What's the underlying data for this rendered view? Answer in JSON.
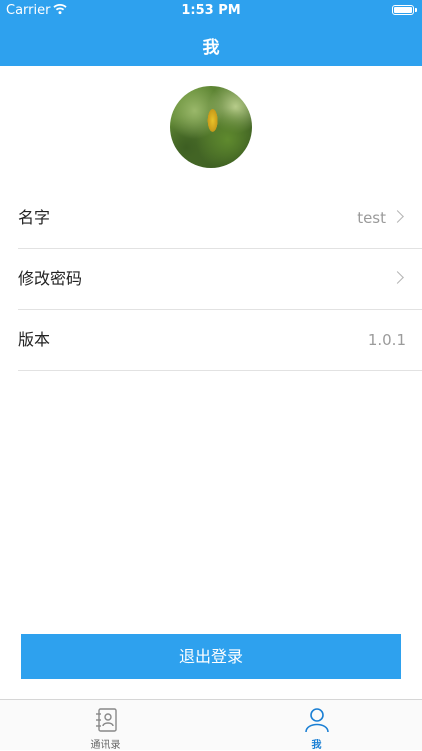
{
  "status_bar": {
    "carrier": "Carrier",
    "time": "1:53 PM"
  },
  "nav": {
    "title": "我"
  },
  "profile": {
    "rows": [
      {
        "label": "名字",
        "value": "test"
      },
      {
        "label": "修改密码",
        "value": ""
      },
      {
        "label": "版本",
        "value": "1.0.1"
      }
    ],
    "logout_label": "退出登录"
  },
  "tab_bar": {
    "tabs": [
      {
        "label": "通讯录",
        "icon": "contacts-icon",
        "active": false
      },
      {
        "label": "我",
        "icon": "person-icon",
        "active": true
      }
    ]
  },
  "colors": {
    "accent": "#2ea1ee",
    "tab_inactive": "#888888",
    "tab_active": "#1a7fd4"
  }
}
